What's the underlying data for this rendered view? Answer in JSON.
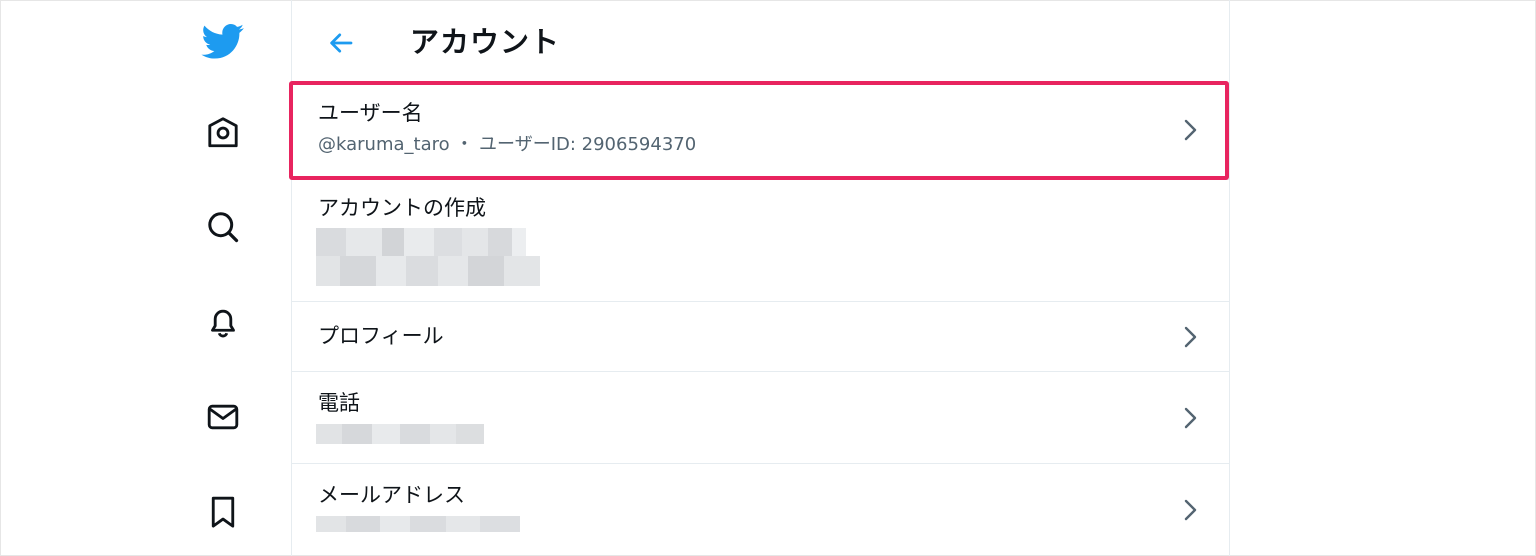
{
  "nav": {
    "items": [
      {
        "id": "logo",
        "icon": "twitter-bird-icon"
      },
      {
        "id": "home",
        "icon": "home-icon"
      },
      {
        "id": "explore",
        "icon": "search-icon"
      },
      {
        "id": "notifications",
        "icon": "bell-icon"
      },
      {
        "id": "messages",
        "icon": "mail-icon"
      },
      {
        "id": "bookmarks",
        "icon": "bookmark-icon"
      }
    ]
  },
  "header": {
    "back_icon": "arrow-left-icon",
    "title": "アカウント"
  },
  "rows": {
    "username": {
      "label": "ユーザー名",
      "sub": "@karuma_taro ・ ユーザーID: 2906594370"
    },
    "created": {
      "label": "アカウントの作成"
    },
    "profile": {
      "label": "プロフィール"
    },
    "phone": {
      "label": "電話"
    },
    "email": {
      "label": "メールアドレス"
    }
  },
  "colors": {
    "accent": "#1d9bf0",
    "highlight": "#e8245f",
    "text": "#0f1419",
    "subtext": "#536471",
    "divider": "#e6ecf0"
  }
}
